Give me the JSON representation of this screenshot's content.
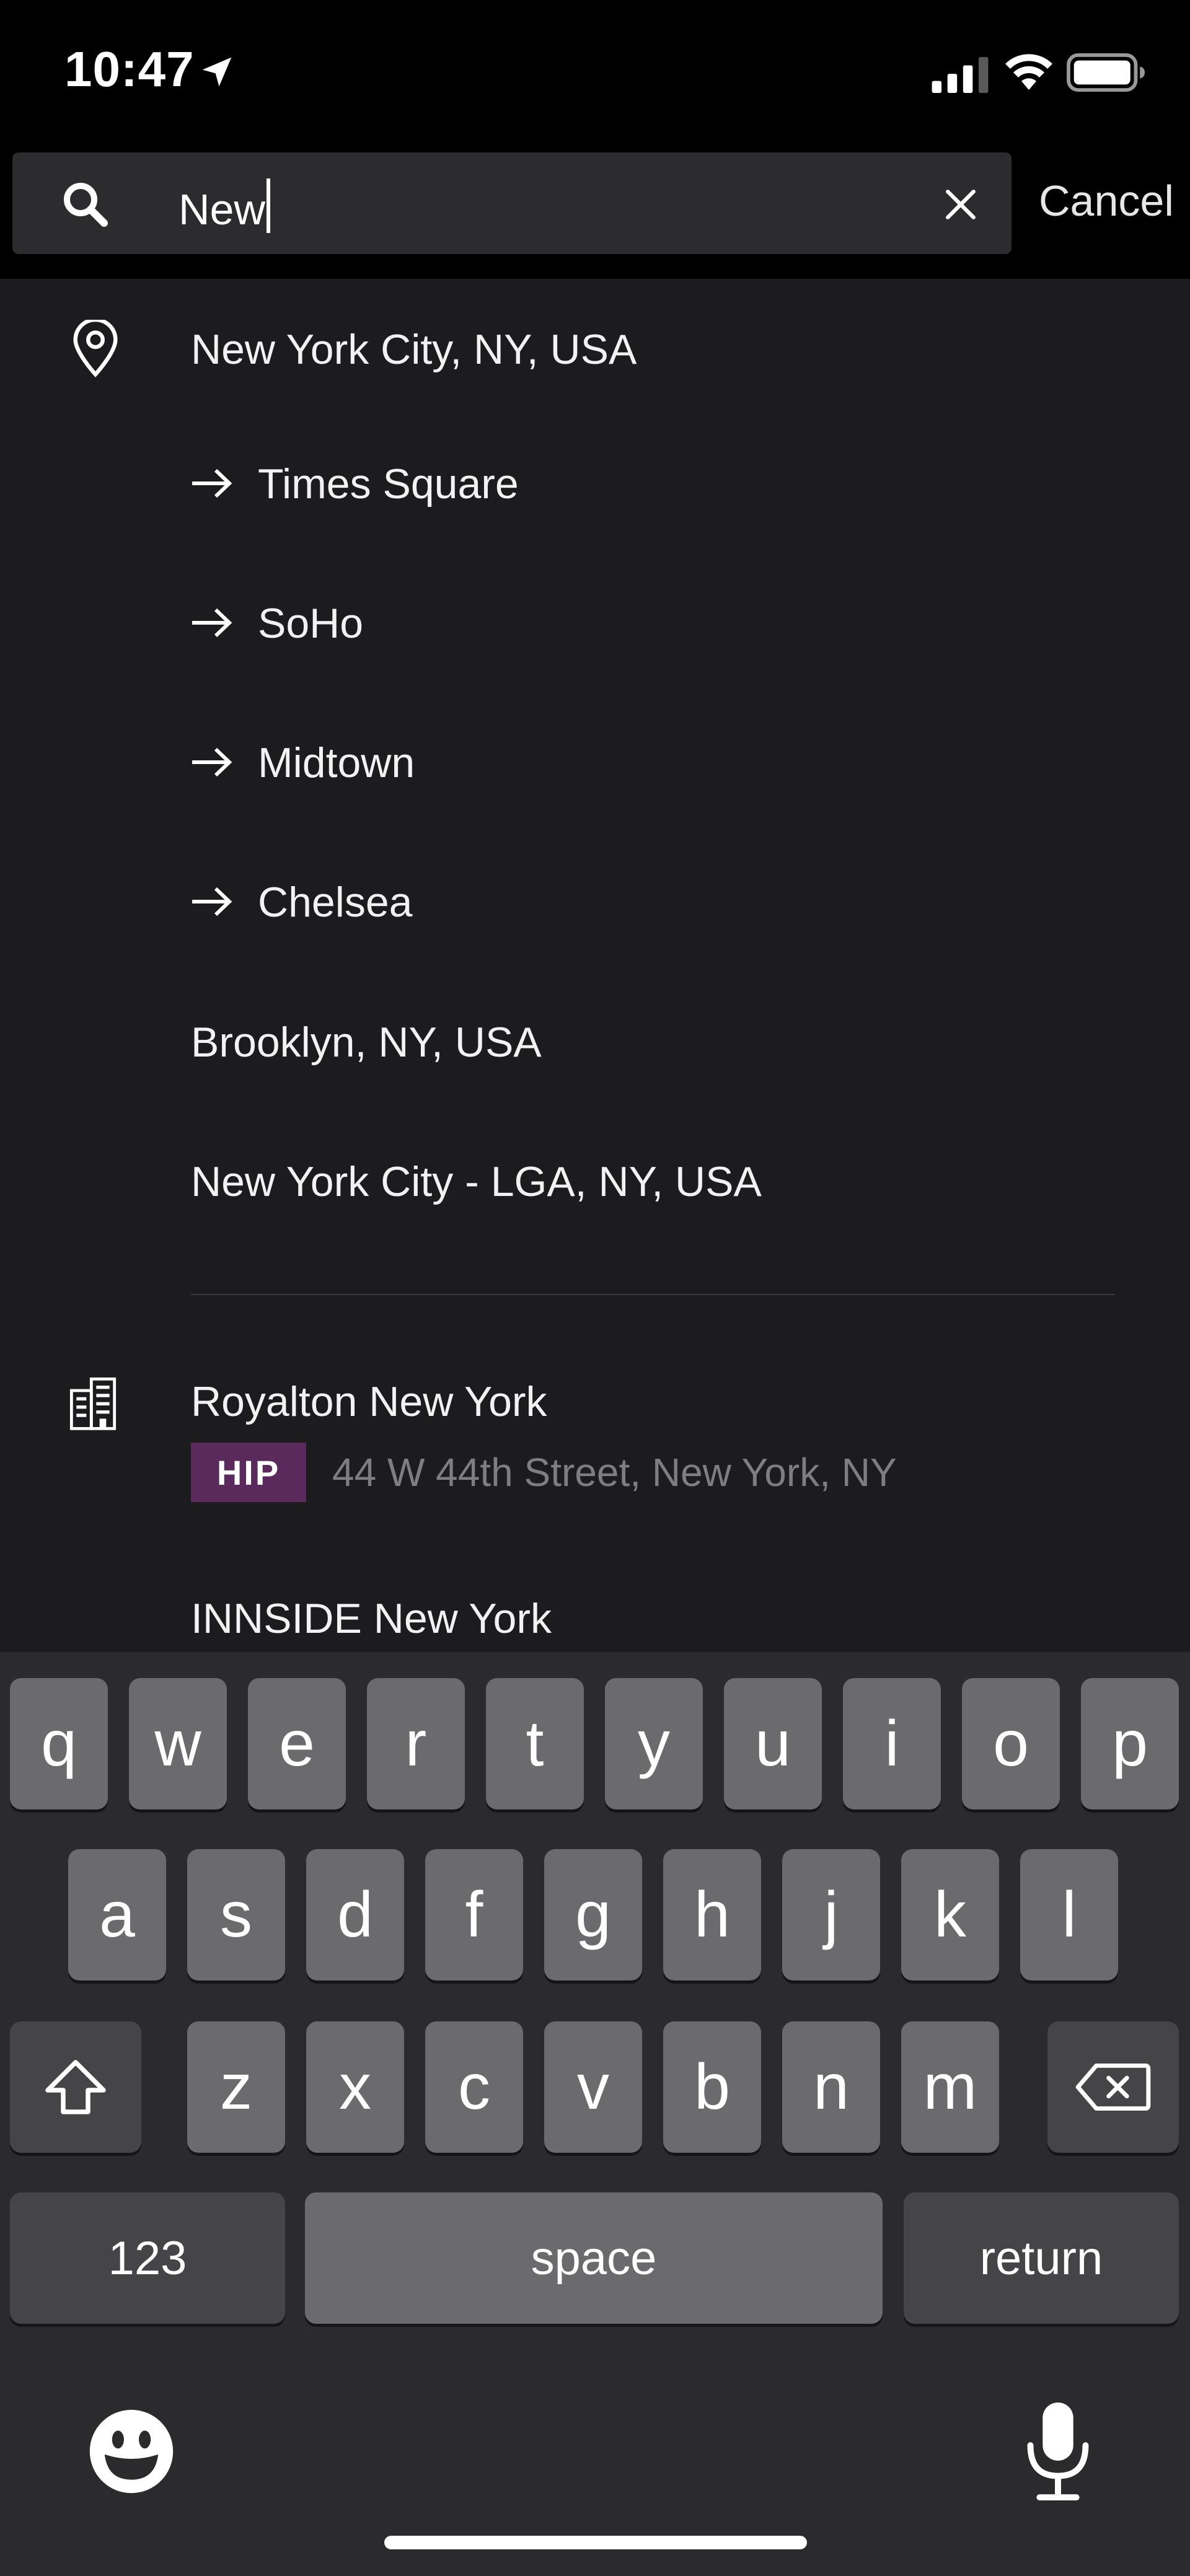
{
  "status_bar": {
    "time": "10:47"
  },
  "search": {
    "query": "New",
    "cancel_label": "Cancel"
  },
  "results": {
    "location": {
      "primary": "New York City, NY, USA",
      "neighborhoods": [
        "Times Square",
        "SoHo",
        "Midtown",
        "Chelsea"
      ],
      "others": [
        "Brooklyn, NY, USA",
        "New York City - LGA, NY, USA"
      ]
    },
    "hotels": [
      {
        "name": "Royalton New York",
        "badge": "HIP",
        "address": "44 W 44th Street, New York, NY"
      },
      {
        "name": "INNSIDE New York"
      }
    ],
    "colors": {
      "background": "#1c1c1e",
      "badge": "#5a2a5c",
      "address": "#7d7d82"
    }
  },
  "keyboard": {
    "row1": [
      "q",
      "w",
      "e",
      "r",
      "t",
      "y",
      "u",
      "i",
      "o",
      "p"
    ],
    "row2": [
      "a",
      "s",
      "d",
      "f",
      "g",
      "h",
      "j",
      "k",
      "l"
    ],
    "row3": [
      "z",
      "x",
      "c",
      "v",
      "b",
      "n",
      "m"
    ],
    "numbers_label": "123",
    "space_label": "space",
    "return_label": "return"
  }
}
